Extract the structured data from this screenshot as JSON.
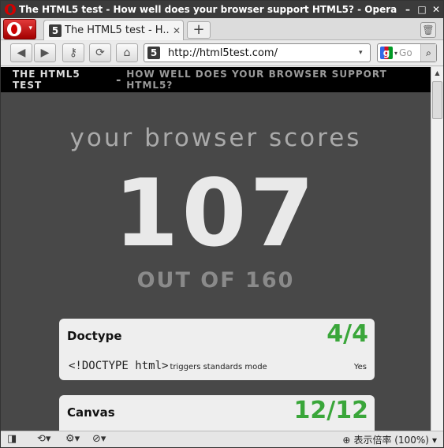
{
  "window": {
    "title": "The HTML5 test - How well does your browser support HTML5? - Opera",
    "controls": [
      "–",
      "□",
      "✕"
    ]
  },
  "tabs": [
    {
      "label": "The HTML5 test - H...",
      "favicon": "5",
      "close": "✕"
    }
  ],
  "toolbar": {
    "new_tab": "+",
    "back_icon": "◀",
    "forward_icon": "▶",
    "key_icon": "⚷",
    "reload_icon": "⟳",
    "home_icon": "⌂",
    "url": "http://html5test.com/",
    "url_dropdown": "▾",
    "search_engine": "g",
    "search_placeholder": "Go",
    "search_go": "🔍"
  },
  "page": {
    "header_title": "THE HTML5 TEST",
    "header_dash": "–",
    "header_subtitle": "HOW WELL DOES YOUR BROWSER SUPPORT HTML5?",
    "scores_label": "your browser scores",
    "score": "107",
    "out_of": "OUT OF 160",
    "cards": [
      {
        "name": "Doctype",
        "points": "4/4",
        "code": "<!DOCTYPE html>",
        "desc": "triggers standards mode",
        "result": "Yes"
      },
      {
        "name": "Canvas",
        "points": "12/12"
      }
    ]
  },
  "statusbar": {
    "zoom_label": "表示倍率 (100%)",
    "zoom_caret": "▾"
  },
  "colors": {
    "page_bg": "#484848",
    "header_bg": "#000000",
    "points_green": "#3aa63a",
    "opera_red": "#cc0000"
  }
}
